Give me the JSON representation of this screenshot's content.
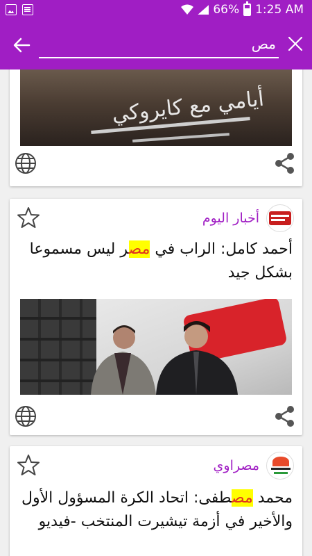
{
  "status_bar": {
    "battery": "66%",
    "time": "1:25 AM"
  },
  "search": {
    "query": "مص"
  },
  "cards": [
    {
      "image_text": "أيامي مع كايروكي"
    },
    {
      "source": "أخبار اليوم",
      "headline_before": "أحمد كامل: الراب في ",
      "headline_match": "مص",
      "headline_after": "ر ليس مسموعا بشكل جيد"
    },
    {
      "source": "مصراوي",
      "headline_before": "محمد ",
      "headline_match": "مص",
      "headline_after": "طفى: اتحاد الكرة المسؤول الأول والأخير في أزمة تيشيرت المنتخب -فيديو"
    }
  ],
  "colors": {
    "accent": "#a01ec4",
    "highlight_bg": "#ffff00",
    "highlight_text": "#e0321e"
  }
}
